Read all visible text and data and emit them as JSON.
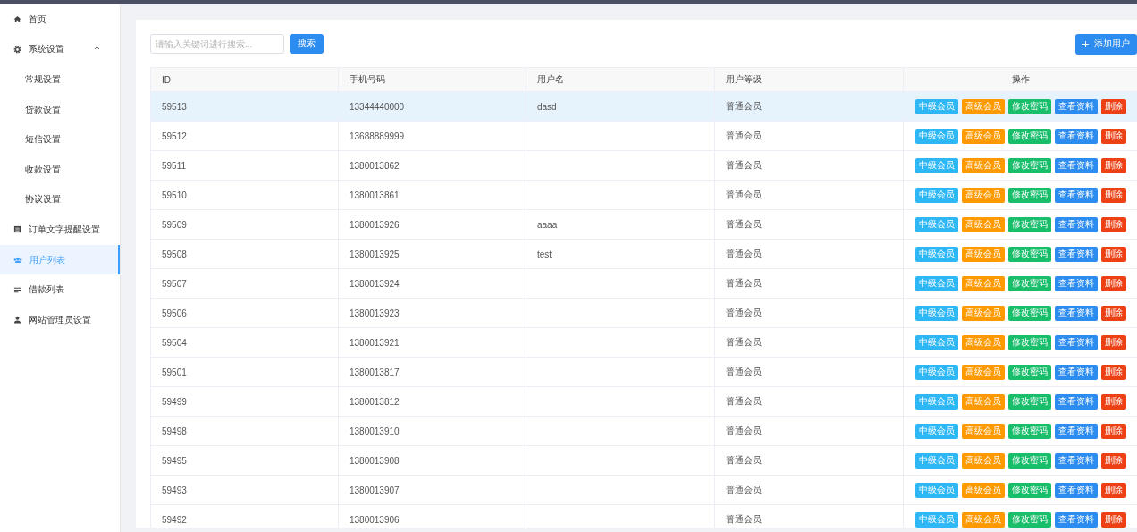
{
  "sidebar": {
    "items": [
      {
        "label": "首页",
        "selected": false
      },
      {
        "label": "系统设置",
        "selected": false,
        "expanded": true,
        "children": [
          {
            "label": "常规设置",
            "selected": false
          },
          {
            "label": "贷款设置",
            "selected": false
          },
          {
            "label": "短信设置",
            "selected": false
          },
          {
            "label": "收款设置",
            "selected": false
          },
          {
            "label": "协议设置",
            "selected": false
          }
        ]
      },
      {
        "label": "订单文字提醒设置",
        "selected": false
      },
      {
        "label": "用户列表",
        "selected": true
      },
      {
        "label": "借款列表",
        "selected": false
      },
      {
        "label": "网站管理员设置",
        "selected": false
      }
    ]
  },
  "toolbar": {
    "search": {
      "placeholder": "请输入关键词进行搜索..."
    },
    "search_button": "搜索",
    "add_button": "添加用户"
  },
  "table": {
    "columns": [
      "ID",
      "手机号码",
      "用户名",
      "用户等级",
      "操作"
    ],
    "rows": [
      {
        "cells": [
          "59513",
          "13344440000",
          "dasd",
          "普通会员"
        ],
        "highlighted": true,
        "actions": [
          {
            "label": "中级会员",
            "kind": "info"
          },
          {
            "label": "高级会员",
            "kind": "warning"
          },
          {
            "label": "修改密码",
            "kind": "success"
          },
          {
            "label": "查看资料",
            "kind": "primary"
          },
          {
            "label": "删除",
            "kind": "danger"
          }
        ]
      },
      {
        "cells": [
          "59512",
          "13688889999",
          "",
          "普通会员"
        ],
        "highlighted": false,
        "actions": [
          {
            "label": "中级会员",
            "kind": "info"
          },
          {
            "label": "高级会员",
            "kind": "warning"
          },
          {
            "label": "修改密码",
            "kind": "success"
          },
          {
            "label": "查看资料",
            "kind": "primary"
          },
          {
            "label": "删除",
            "kind": "danger"
          }
        ]
      },
      {
        "cells": [
          "59511",
          "1380013862",
          "",
          "普通会员"
        ],
        "highlighted": false,
        "actions": [
          {
            "label": "中级会员",
            "kind": "info"
          },
          {
            "label": "高级会员",
            "kind": "warning"
          },
          {
            "label": "修改密码",
            "kind": "success"
          },
          {
            "label": "查看资料",
            "kind": "primary"
          },
          {
            "label": "删除",
            "kind": "danger"
          }
        ]
      },
      {
        "cells": [
          "59510",
          "1380013861",
          "",
          "普通会员"
        ],
        "highlighted": false,
        "actions": [
          {
            "label": "中级会员",
            "kind": "info"
          },
          {
            "label": "高级会员",
            "kind": "warning"
          },
          {
            "label": "修改密码",
            "kind": "success"
          },
          {
            "label": "查看资料",
            "kind": "primary"
          },
          {
            "label": "删除",
            "kind": "danger"
          }
        ]
      },
      {
        "cells": [
          "59509",
          "1380013926",
          "aaaa",
          "普通会员"
        ],
        "highlighted": false,
        "actions": [
          {
            "label": "中级会员",
            "kind": "info"
          },
          {
            "label": "高级会员",
            "kind": "warning"
          },
          {
            "label": "修改密码",
            "kind": "success"
          },
          {
            "label": "查看资料",
            "kind": "primary"
          },
          {
            "label": "删除",
            "kind": "danger"
          }
        ]
      },
      {
        "cells": [
          "59508",
          "1380013925",
          "test",
          "普通会员"
        ],
        "highlighted": false,
        "actions": [
          {
            "label": "中级会员",
            "kind": "info"
          },
          {
            "label": "高级会员",
            "kind": "warning"
          },
          {
            "label": "修改密码",
            "kind": "success"
          },
          {
            "label": "查看资料",
            "kind": "primary"
          },
          {
            "label": "删除",
            "kind": "danger"
          }
        ]
      },
      {
        "cells": [
          "59507",
          "1380013924",
          "",
          "普通会员"
        ],
        "highlighted": false,
        "actions": [
          {
            "label": "中级会员",
            "kind": "info"
          },
          {
            "label": "高级会员",
            "kind": "warning"
          },
          {
            "label": "修改密码",
            "kind": "success"
          },
          {
            "label": "查看资料",
            "kind": "primary"
          },
          {
            "label": "删除",
            "kind": "danger"
          }
        ]
      },
      {
        "cells": [
          "59506",
          "1380013923",
          "",
          "普通会员"
        ],
        "highlighted": false,
        "actions": [
          {
            "label": "中级会员",
            "kind": "info"
          },
          {
            "label": "高级会员",
            "kind": "warning"
          },
          {
            "label": "修改密码",
            "kind": "success"
          },
          {
            "label": "查看资料",
            "kind": "primary"
          },
          {
            "label": "删除",
            "kind": "danger"
          }
        ]
      },
      {
        "cells": [
          "59504",
          "1380013921",
          "",
          "普通会员"
        ],
        "highlighted": false,
        "actions": [
          {
            "label": "中级会员",
            "kind": "info"
          },
          {
            "label": "高级会员",
            "kind": "warning"
          },
          {
            "label": "修改密码",
            "kind": "success"
          },
          {
            "label": "查看资料",
            "kind": "primary"
          },
          {
            "label": "删除",
            "kind": "danger"
          }
        ]
      },
      {
        "cells": [
          "59501",
          "1380013817",
          "",
          "普通会员"
        ],
        "highlighted": false,
        "actions": [
          {
            "label": "中级会员",
            "kind": "info"
          },
          {
            "label": "高级会员",
            "kind": "warning"
          },
          {
            "label": "修改密码",
            "kind": "success"
          },
          {
            "label": "查看资料",
            "kind": "primary"
          },
          {
            "label": "删除",
            "kind": "danger"
          }
        ]
      },
      {
        "cells": [
          "59499",
          "1380013812",
          "",
          "普通会员"
        ],
        "highlighted": false,
        "actions": [
          {
            "label": "中级会员",
            "kind": "info"
          },
          {
            "label": "高级会员",
            "kind": "warning"
          },
          {
            "label": "修改密码",
            "kind": "success"
          },
          {
            "label": "查看资料",
            "kind": "primary"
          },
          {
            "label": "删除",
            "kind": "danger"
          }
        ]
      },
      {
        "cells": [
          "59498",
          "1380013910",
          "",
          "普通会员"
        ],
        "highlighted": false,
        "actions": [
          {
            "label": "中级会员",
            "kind": "info"
          },
          {
            "label": "高级会员",
            "kind": "warning"
          },
          {
            "label": "修改密码",
            "kind": "success"
          },
          {
            "label": "查看资料",
            "kind": "primary"
          },
          {
            "label": "删除",
            "kind": "danger"
          }
        ]
      },
      {
        "cells": [
          "59495",
          "1380013908",
          "",
          "普通会员"
        ],
        "highlighted": false,
        "actions": [
          {
            "label": "中级会员",
            "kind": "info"
          },
          {
            "label": "高级会员",
            "kind": "warning"
          },
          {
            "label": "修改密码",
            "kind": "success"
          },
          {
            "label": "查看资料",
            "kind": "primary"
          },
          {
            "label": "删除",
            "kind": "danger"
          }
        ]
      },
      {
        "cells": [
          "59493",
          "1380013907",
          "",
          "普通会员"
        ],
        "highlighted": false,
        "actions": [
          {
            "label": "中级会员",
            "kind": "info"
          },
          {
            "label": "高级会员",
            "kind": "warning"
          },
          {
            "label": "修改密码",
            "kind": "success"
          },
          {
            "label": "查看资料",
            "kind": "primary"
          },
          {
            "label": "删除",
            "kind": "danger"
          }
        ]
      },
      {
        "cells": [
          "59492",
          "1380013906",
          "",
          "普通会员"
        ],
        "highlighted": false,
        "actions": [
          {
            "label": "中级会员",
            "kind": "info"
          },
          {
            "label": "高级会员",
            "kind": "warning"
          },
          {
            "label": "修改密码",
            "kind": "success"
          },
          {
            "label": "查看资料",
            "kind": "primary"
          },
          {
            "label": "删除",
            "kind": "danger"
          }
        ]
      }
    ]
  }
}
